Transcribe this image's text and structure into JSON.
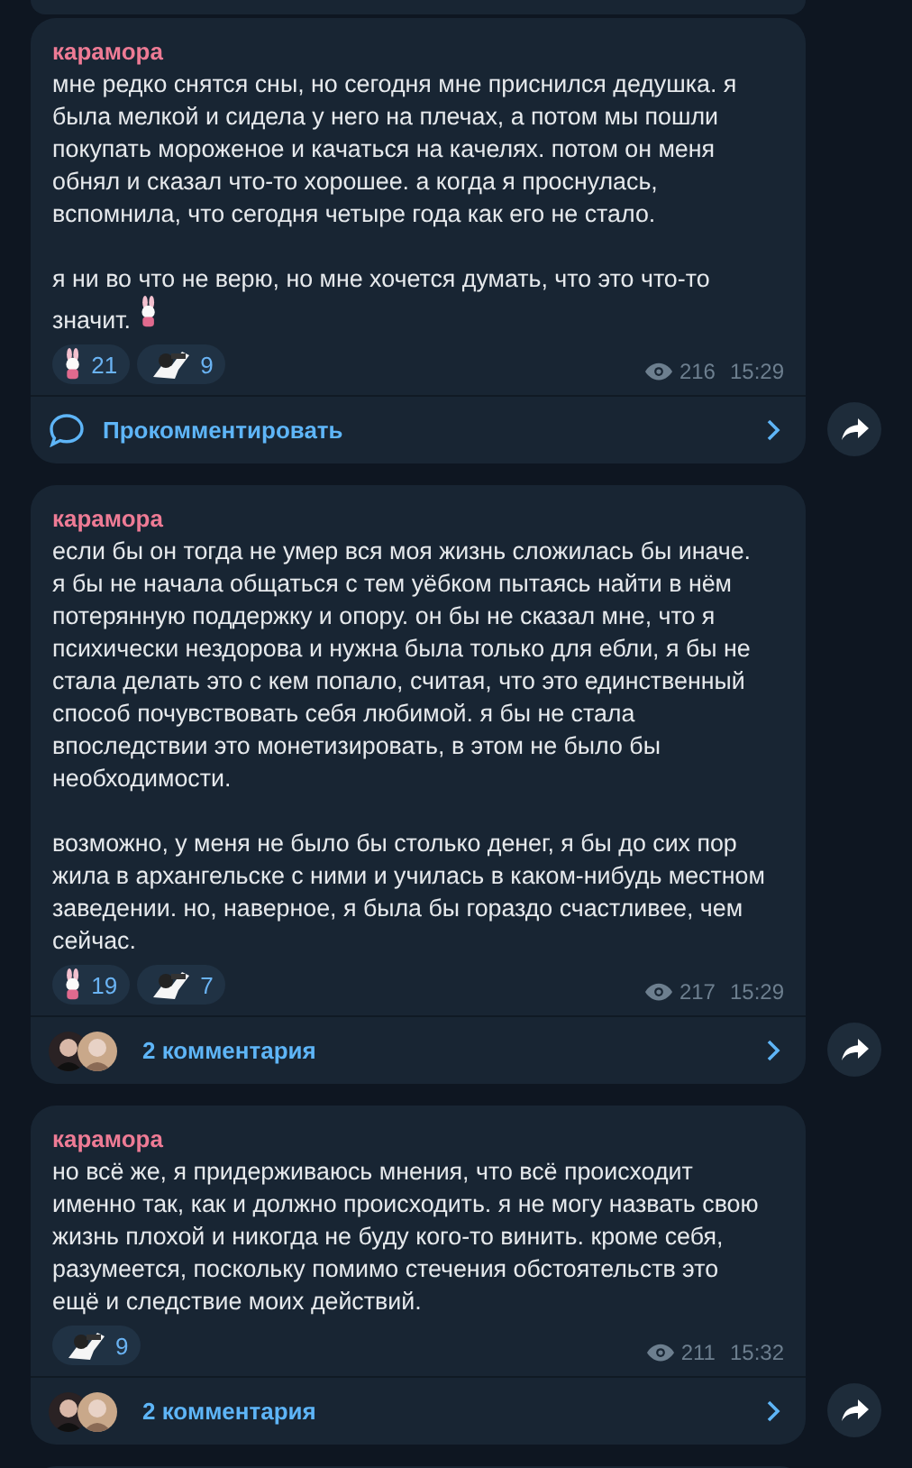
{
  "messages": [
    {
      "author": "карамора",
      "paragraphs": [
        "мне редко снятся сны, но сегодня мне приснился дедушка. я была мелкой и сидела у него на плечах, а потом мы пошли покупать мороженое и качаться на качелях. потом он меня обнял и сказал что-то хорошее. а когда я проснулась, вспомнила, что сегодня четыре года как его не стало.",
        "я ни во что не верю, но мне хочется думать, что это что-то значит."
      ],
      "end_emoji": {
        "kind": "bunny"
      },
      "reactions": [
        {
          "kind": "bunny",
          "count": "21"
        },
        {
          "kind": "figure",
          "count": "9"
        }
      ],
      "views": "216",
      "time": "15:29",
      "comments": {
        "kind": "prompt",
        "label": "Прокомментировать"
      }
    },
    {
      "author": "карамора",
      "paragraphs": [
        "если бы он тогда не умер вся моя жизнь сложилась бы иначе. я бы не начала общаться с тем уёбком пытаясь найти в нём потерянную поддержку и опору. он бы не сказал мне, что я психически нездорова и нужна была только для ебли, я бы не стала делать это с кем попало, считая, что это единственный способ почувствовать себя любимой. я бы не стала впоследствии это монетизировать, в этом не было бы необходимости.",
        "возможно, у меня не было бы столько денег, я бы до сих пор жила в архангельске с ними и училась в каком-нибудь местном заведении. но, наверное, я была бы гораздо счастливее, чем сейчас."
      ],
      "reactions": [
        {
          "kind": "bunny",
          "count": "19"
        },
        {
          "kind": "figure",
          "count": "7"
        }
      ],
      "views": "217",
      "time": "15:29",
      "comments": {
        "kind": "count",
        "label": "2 комментария"
      }
    },
    {
      "author": "карамора",
      "paragraphs": [
        "но всё же, я придерживаюсь мнения, что всё происходит именно так, как и должно происходить. я не могу назвать свою жизнь плохой и никогда не буду кого-то винить. кроме себя, разумеется, поскольку помимо стечения обстоятельств это ещё и следствие моих действий."
      ],
      "reactions": [
        {
          "kind": "figure",
          "count": "9"
        }
      ],
      "views": "211",
      "time": "15:32",
      "comments": {
        "kind": "count",
        "label": "2 комментария"
      }
    }
  ]
}
